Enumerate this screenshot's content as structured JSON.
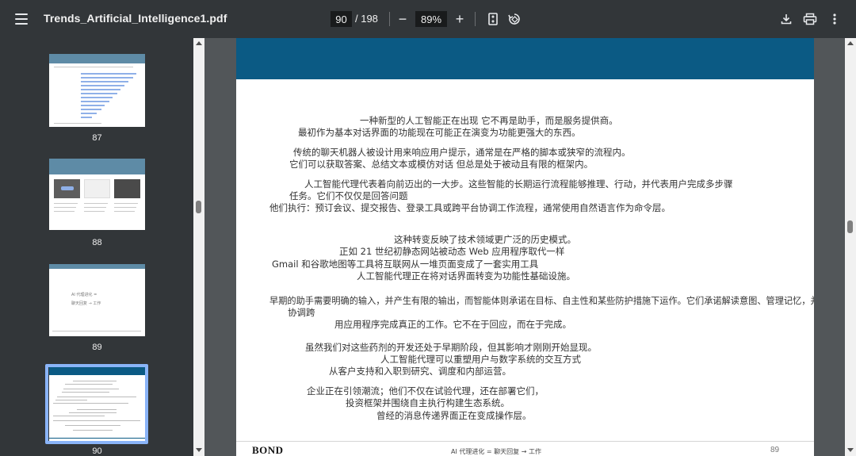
{
  "toolbar": {
    "title": "Trends_Artificial_Intelligence1.pdf",
    "page_current": "90",
    "page_total": "/ 198",
    "zoom": "89%",
    "zoom_out": "−",
    "zoom_in": "+"
  },
  "sidebar": {
    "thumbnails": [
      {
        "label": "87"
      },
      {
        "label": "88"
      },
      {
        "label": "89",
        "text1": "AI 代理进化 =",
        "text2": "聊天回复 → 工作"
      },
      {
        "label": "90"
      }
    ]
  },
  "page": {
    "lines": [
      "一种新型的人工智能正在出现   它不再是助手，而是服务提供商。",
      "最初作为基本对话界面的功能现在可能正在演变为功能更强大的东西。",
      "传统的聊天机器人被设计用来响应用户提示，通常是在严格的脚本或狭窄的流程内。",
      "它们可以获取答案、总结文本或模仿对话   但总是处于被动且有限的框架内。",
      "人工智能代理代表着向前迈出的一大步。这些智能的长期运行流程能够推理、行动，并代表用户完成多步骤",
      "任务。它们不仅仅是回答问题",
      "他们执行：预订会议、提交报告、登录工具或跨平台协调工作流程，通常使用自然语言作为命令层。",
      "这种转变反映了技术领域更广泛的历史模式。",
      "正如 21 世纪初静态网站被动态 Web 应用程序取代一样",
      "Gmail 和谷歌地图等工具将互联网从一堆页面变成了一套实用工具",
      "人工智能代理正在将对话界面转变为功能性基础设施。",
      "早期的助手需要明确的输入，并产生有限的输出，而智能体则承诺在目标、自主性和某些防护措施下运作。它们承诺解读意图、管理记忆，并",
      "协调跨",
      "用应用程序完成真正的工作。它不在于回应，而在于完成。",
      "虽然我们对这些药剂的开发还处于早期阶段，但其影响才刚刚开始显现。",
      "人工智能代理可以重塑用户与数字系统的交互方式",
      "从客户支持和入职到研究、调度和内部运营。",
      "企业正在引领潮流；他们不仅在试验代理，还在部署它们，",
      "投资框架并围绕自主执行构建生态系统。",
      "曾经的消息传递界面正在变成操作层。"
    ],
    "footer_brand": "BOND",
    "footer_center": "AI 代理进化 = 聊天回复 → 工作",
    "footer_page": "89"
  },
  "icons": {
    "menu": "menu-icon",
    "fit": "fit-page-icon",
    "rotate": "rotate-icon",
    "download": "download-icon",
    "print": "print-icon",
    "more": "more-vert-icon"
  }
}
